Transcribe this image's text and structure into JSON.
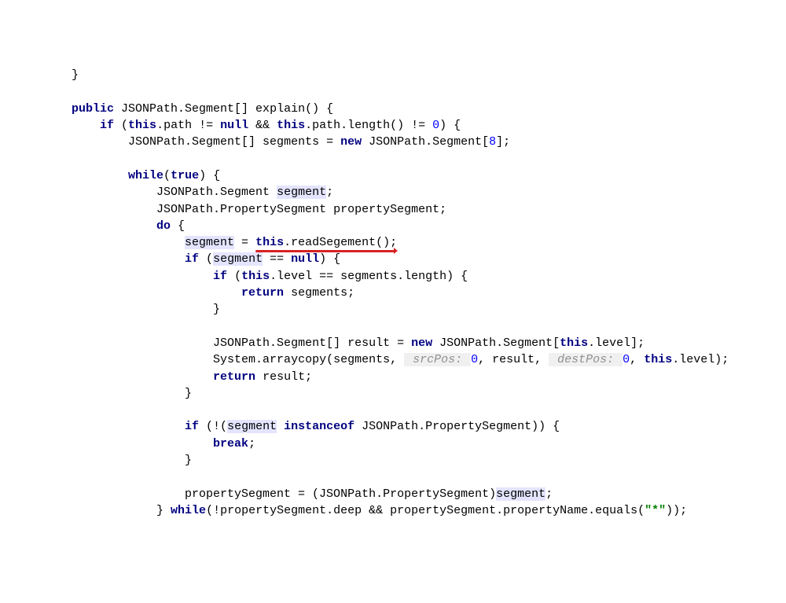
{
  "code": {
    "line0": "}",
    "line2_public": "public",
    "line2_rest": " JSONPath.Segment[] explain() {",
    "line3_if": "if",
    "line3_a": " (",
    "line3_this1": "this",
    "line3_b": ".path != ",
    "line3_null": "null",
    "line3_c": " && ",
    "line3_this2": "this",
    "line3_d": ".path.length() != ",
    "line3_zero": "0",
    "line3_e": ") {",
    "line4_a": "JSONPath.Segment[] segments = ",
    "line4_new": "new",
    "line4_b": " JSONPath.Segment[",
    "line4_eight": "8",
    "line4_c": "];",
    "line6_while": "while",
    "line6_a": "(",
    "line6_true": "true",
    "line6_b": ") {",
    "line7_a": "JSONPath.Segment ",
    "line7_seg": "segment",
    "line7_b": ";",
    "line8": "JSONPath.PropertySegment propertySegment;",
    "line9_do": "do",
    "line9_b": " {",
    "line10_seg": "segment",
    "line10_a": " = ",
    "line10_this": "this",
    "line10_method": ".readSegement()",
    "line10_b": ";",
    "line11_if": "if",
    "line11_a": " (",
    "line11_seg": "segment",
    "line11_b": " == ",
    "line11_null": "null",
    "line11_c": ") {",
    "line12_if": "if",
    "line12_a": " (",
    "line12_this": "this",
    "line12_b": ".level == segments.length) {",
    "line13_return": "return",
    "line13_a": " segments;",
    "line14": "}",
    "line16_a": "JSONPath.Segment[] result = ",
    "line16_new": "new",
    "line16_b": " JSONPath.Segment[",
    "line16_this": "this",
    "line16_c": ".level];",
    "line17_a": "System.arraycopy(segments, ",
    "line17_hint1": " srcPos: ",
    "line17_zero1": "0",
    "line17_b": ", result, ",
    "line17_hint2": " destPos: ",
    "line17_zero2": "0",
    "line17_c": ", ",
    "line17_this": "this",
    "line17_d": ".level);",
    "line18_return": "return",
    "line18_a": " result;",
    "line19": "}",
    "line21_if": "if",
    "line21_a": " (!(",
    "line21_seg": "segment",
    "line21_b": " ",
    "line21_instanceof": "instanceof",
    "line21_c": " JSONPath.PropertySegment)) {",
    "line22_break": "break",
    "line22_a": ";",
    "line23": "}",
    "line25_a": "propertySegment = (JSONPath.PropertySegment)",
    "line25_seg": "segment",
    "line25_b": ";",
    "line26_a": "} ",
    "line26_while": "while",
    "line26_b": "(!propertySegment.deep && propertySegment.propertyName.equals(",
    "line26_str": "\"*\"",
    "line26_c": "));"
  }
}
